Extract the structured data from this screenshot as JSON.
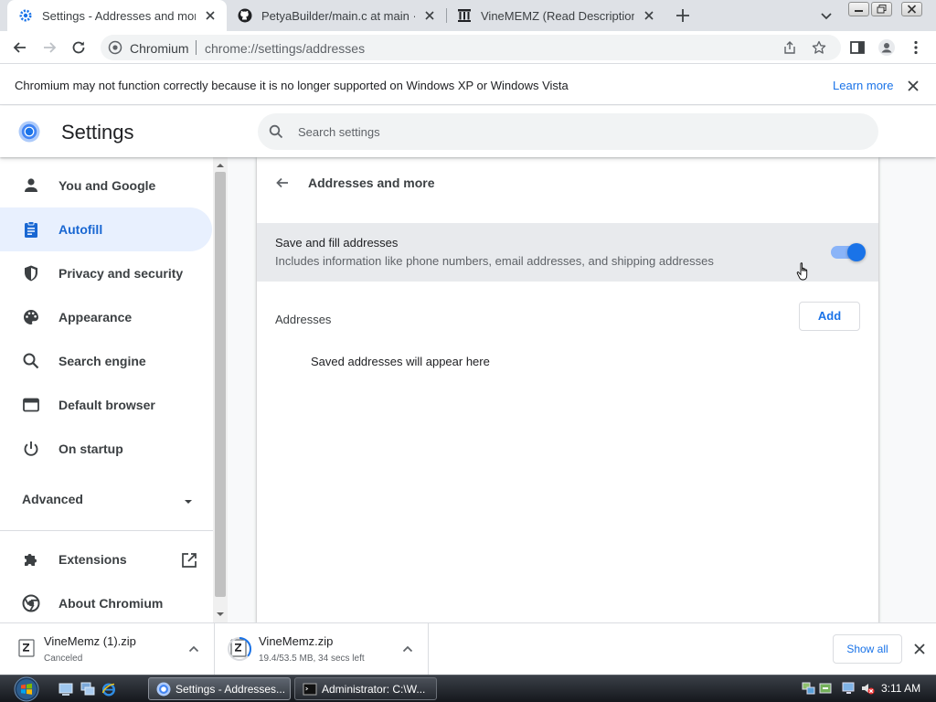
{
  "browser": {
    "tabs": [
      {
        "title": "Settings - Addresses and more",
        "active": true,
        "icon": "gear-icon"
      },
      {
        "title": "PetyaBuilder/main.c at main · Hil",
        "active": false,
        "icon": "github-icon"
      },
      {
        "title": "VineMEMZ (Read Description) : F",
        "active": false,
        "icon": "archive-icon"
      }
    ],
    "omnibox": {
      "origin": "Chromium",
      "url": "chrome://settings/addresses"
    }
  },
  "infobar": {
    "message": "Chromium may not function correctly because it is no longer supported on Windows XP or Windows Vista",
    "link": "Learn more"
  },
  "header": {
    "title": "Settings",
    "search_placeholder": "Search settings"
  },
  "sidebar": {
    "items": [
      {
        "label": "You and Google",
        "icon": "person-icon",
        "active": false
      },
      {
        "label": "Autofill",
        "icon": "clipboard-icon",
        "active": true
      },
      {
        "label": "Privacy and security",
        "icon": "shield-icon",
        "active": false
      },
      {
        "label": "Appearance",
        "icon": "palette-icon",
        "active": false
      },
      {
        "label": "Search engine",
        "icon": "search-icon",
        "active": false
      },
      {
        "label": "Default browser",
        "icon": "browser-window-icon",
        "active": false
      },
      {
        "label": "On startup",
        "icon": "power-icon",
        "active": false
      }
    ],
    "advanced": "Advanced",
    "extensions": "Extensions",
    "about": "About Chromium"
  },
  "page": {
    "title": "Addresses and more",
    "toggle": {
      "label": "Save and fill addresses",
      "sublabel": "Includes information like phone numbers, email addresses, and shipping addresses",
      "on": true
    },
    "addresses_heading": "Addresses",
    "add_button": "Add",
    "empty_message": "Saved addresses will appear here"
  },
  "downloads": {
    "items": [
      {
        "name": "VineMemz (1).zip",
        "status": "Canceled"
      },
      {
        "name": "VineMemz.zip",
        "status": "19.4/53.5 MB, 34 secs left",
        "progress": 0.36
      }
    ],
    "show_all": "Show all"
  },
  "taskbar": {
    "tasks": [
      {
        "label": "Settings - Addresses...",
        "active": true
      },
      {
        "label": "Administrator: C:\\W...",
        "active": false
      }
    ],
    "clock": "3:11 AM"
  },
  "colors": {
    "accent": "#1a73e8",
    "active_nav_bg": "#e8f0fe",
    "toggle_track": "#8ab4f8"
  }
}
